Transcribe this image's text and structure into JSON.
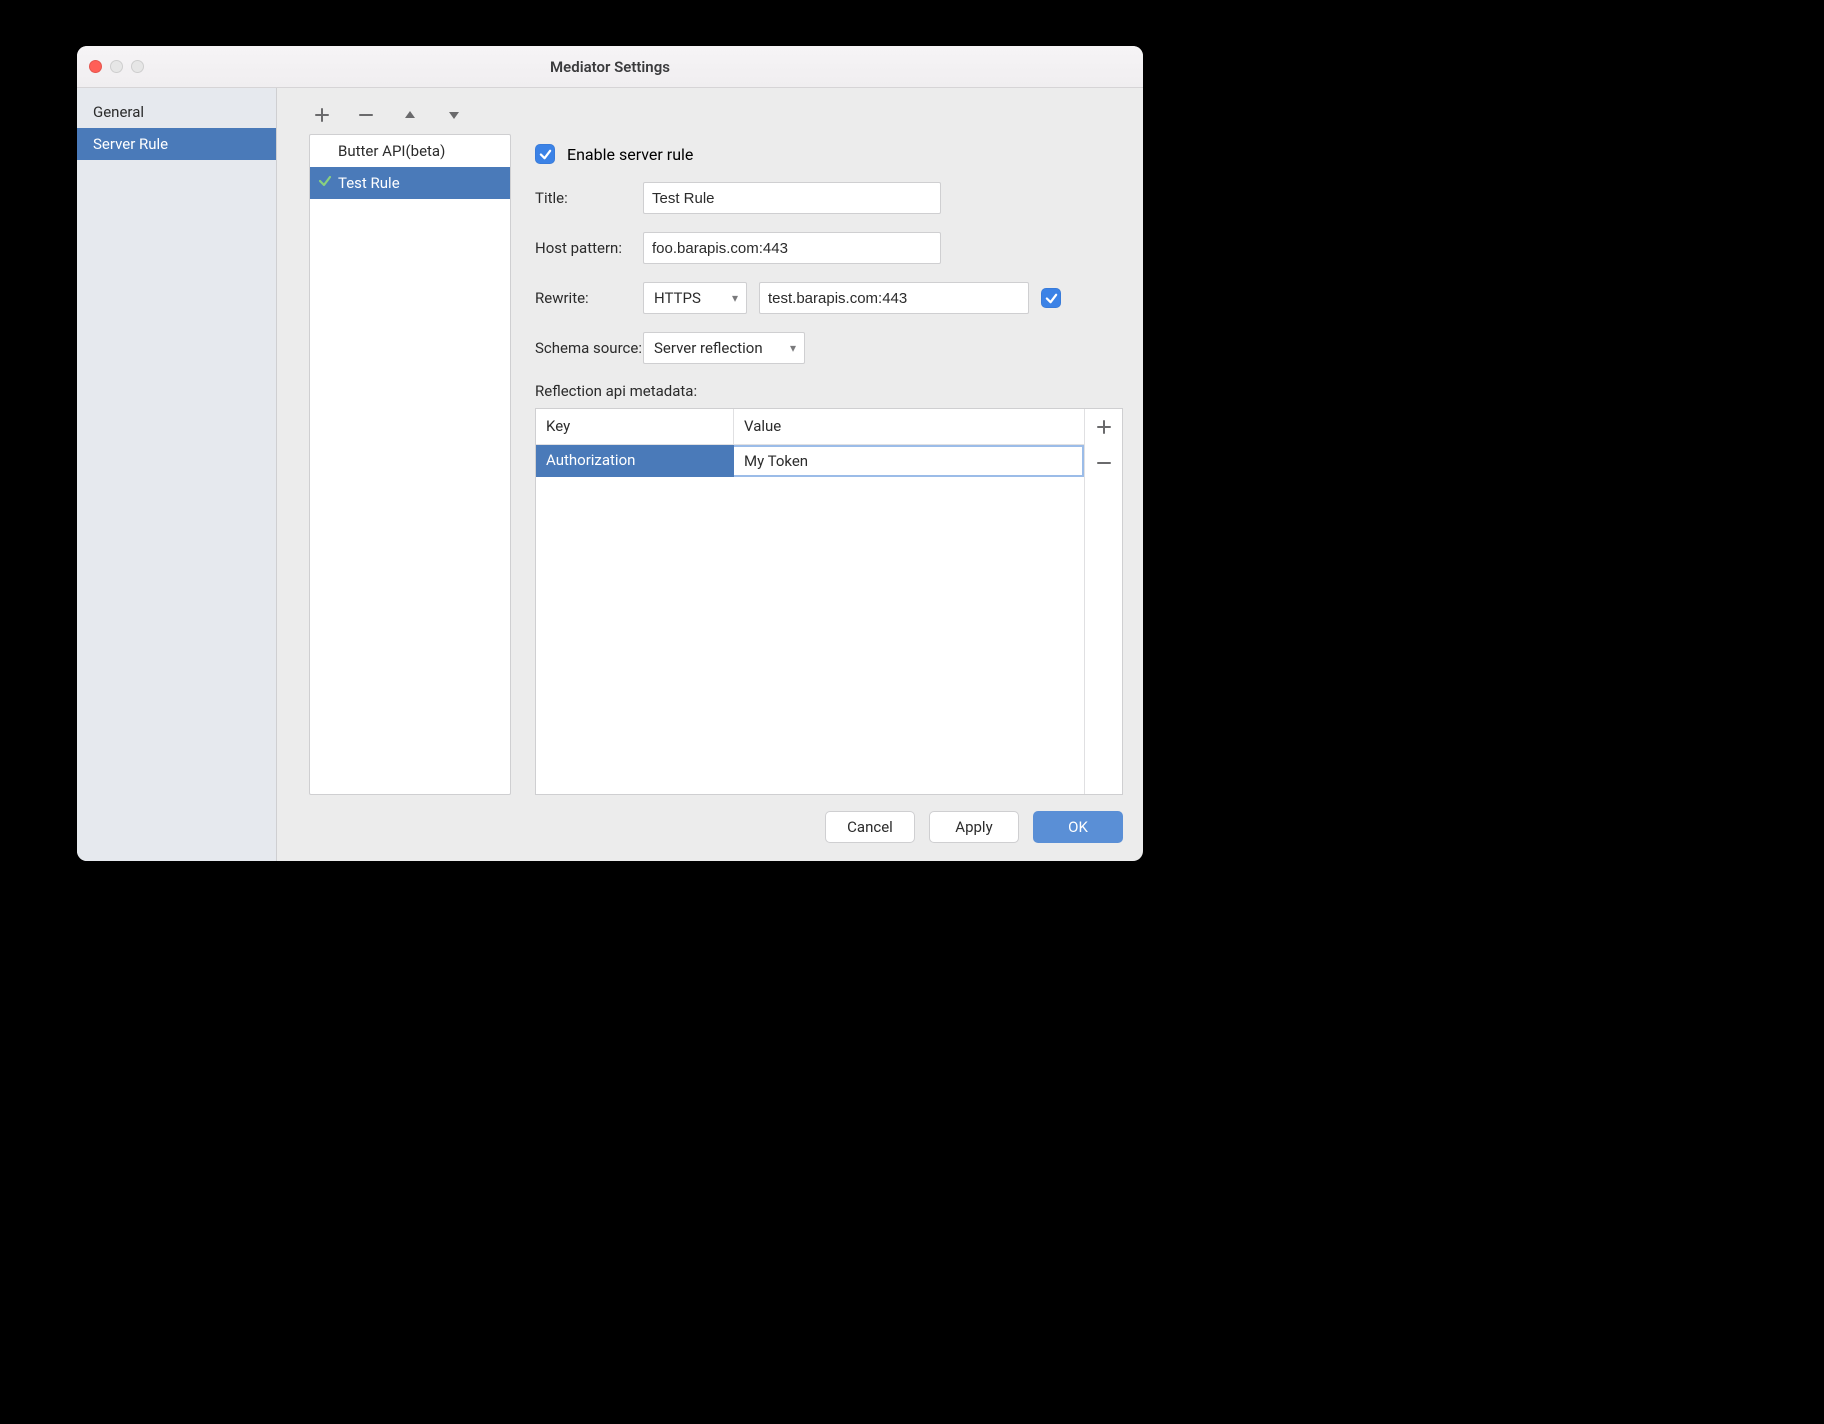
{
  "window": {
    "title": "Mediator Settings"
  },
  "sidebar": {
    "items": [
      {
        "label": "General",
        "selected": false
      },
      {
        "label": "Server Rule",
        "selected": true
      }
    ]
  },
  "rules": {
    "toolbar": {
      "add": "+",
      "remove": "−",
      "up": "▴",
      "down": "▾"
    },
    "items": [
      {
        "label": "Butter API(beta)",
        "enabled": false,
        "selected": false
      },
      {
        "label": "Test Rule",
        "enabled": true,
        "selected": true
      }
    ]
  },
  "form": {
    "enable_label": "Enable server rule",
    "title_label": "Title:",
    "title_value": "Test Rule",
    "host_label": "Host pattern:",
    "host_value": "foo.barapis.com:443",
    "rewrite_label": "Rewrite:",
    "rewrite_scheme": "HTTPS",
    "rewrite_host": "test.barapis.com:443",
    "rewrite_check": true,
    "schema_label": "Schema source:",
    "schema_value": "Server reflection",
    "metadata_label": "Reflection api metadata:",
    "metadata": {
      "header_key": "Key",
      "header_value": "Value",
      "rows": [
        {
          "key": "Authorization",
          "value": "My  Token"
        }
      ]
    }
  },
  "footer": {
    "cancel": "Cancel",
    "apply": "Apply",
    "ok": "OK"
  }
}
